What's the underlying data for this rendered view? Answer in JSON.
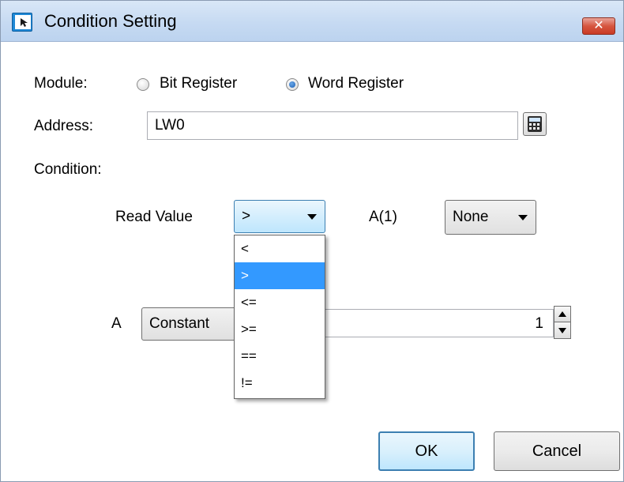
{
  "window": {
    "title": "Condition Setting",
    "close_glyph": "✕"
  },
  "module": {
    "label": "Module:",
    "options": [
      {
        "label": "Bit Register",
        "checked": false
      },
      {
        "label": "Word Register",
        "checked": true
      }
    ]
  },
  "address": {
    "label": "Address:",
    "value": "LW0",
    "icon": "calculator-icon"
  },
  "condition": {
    "label": "Condition:",
    "read_value_label": "Read Value",
    "operator": {
      "selected": ">",
      "options": [
        "<",
        ">",
        "<=",
        ">=",
        "==",
        "!="
      ],
      "selected_index": 1
    },
    "a1_label": "A(1)",
    "a1_select": "None"
  },
  "a_row": {
    "label": "A",
    "type_select": "Constant",
    "value": "1"
  },
  "buttons": {
    "ok": "OK",
    "cancel": "Cancel"
  },
  "colors": {
    "accent": "#3399ff",
    "close": "#d6553f",
    "titlebar": "#c6daf2"
  }
}
